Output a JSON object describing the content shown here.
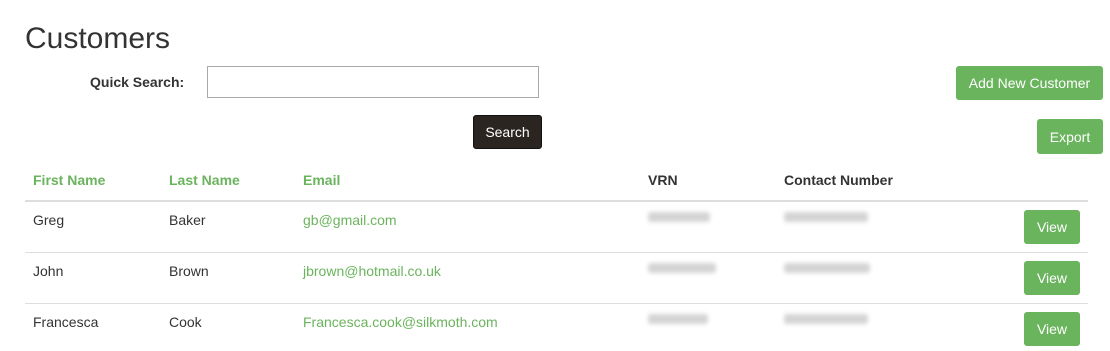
{
  "page": {
    "title": "Customers"
  },
  "search": {
    "label": "Quick Search:",
    "value": "",
    "placeholder": "",
    "button_label": "Search"
  },
  "actions": {
    "add_label": "Add New Customer",
    "export_label": "Export"
  },
  "table": {
    "columns": [
      "First Name",
      "Last Name",
      "Email",
      "VRN",
      "Contact Number"
    ],
    "rows": [
      {
        "first": "Greg",
        "last": "Baker",
        "email": "gb@gmail.com",
        "vrn": "[redacted]",
        "contact": "[redacted]",
        "view_label": "View"
      },
      {
        "first": "John",
        "last": "Brown",
        "email": "jbrown@hotmail.co.uk",
        "vrn": "[redacted]",
        "contact": "[redacted]",
        "view_label": "View"
      },
      {
        "first": "Francesca",
        "last": "Cook",
        "email": "Francesca.cook@silkmoth.com",
        "vrn": "[redacted]",
        "contact": "[redacted]",
        "view_label": "View"
      }
    ]
  },
  "colors": {
    "accent": "#6ab45d",
    "dark_button": "#2b2522",
    "text": "#333333",
    "border": "#dddddd"
  }
}
